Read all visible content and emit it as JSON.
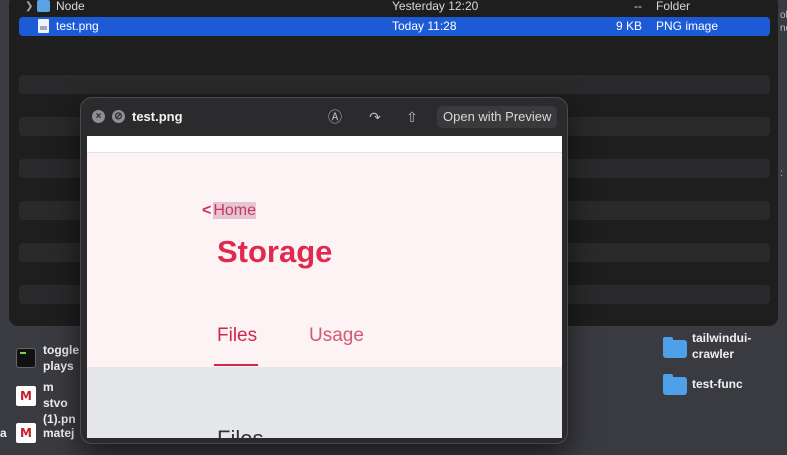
{
  "finder": {
    "rows": [
      {
        "name": "Node",
        "date": "Yesterday 12:20",
        "size": "--",
        "kind": "Folder",
        "icon": "folder-icon",
        "expandable": true,
        "selected": false
      },
      {
        "name": "test.png",
        "date": "Today 11:28",
        "size": "9 KB",
        "kind": "PNG image",
        "icon": "png-file-icon",
        "expandable": false,
        "selected": true
      }
    ],
    "edge_fragments": [
      "ok",
      "nc",
      ":"
    ]
  },
  "desktop": {
    "left_items": [
      {
        "label_lines": [
          "toggle",
          "plays"
        ],
        "icon": "terminal-icon"
      },
      {
        "label_lines": [
          "m stvo",
          "(1).pn"
        ],
        "icon": "m-file-icon"
      },
      {
        "label_lines": [
          "matej"
        ],
        "icon": "m-file-icon",
        "prefix": "a"
      }
    ],
    "right_items": [
      {
        "label_lines": [
          "tailwindui-",
          "crawler"
        ],
        "icon": "folder-icon"
      },
      {
        "label_lines": [
          "test-func"
        ],
        "icon": "folder-icon"
      }
    ]
  },
  "quicklook": {
    "title": "test.png",
    "open_button": "Open with Preview",
    "preview": {
      "back_link": "Home",
      "page_title": "Storage",
      "tabs": [
        {
          "label": "Files",
          "active": true
        },
        {
          "label": "Usage",
          "active": false
        }
      ],
      "section_heading": "Files"
    }
  },
  "colors": {
    "selection": "#1d5bd6",
    "accent": "#e0294f",
    "preview_bg": "#fdf2f4"
  }
}
